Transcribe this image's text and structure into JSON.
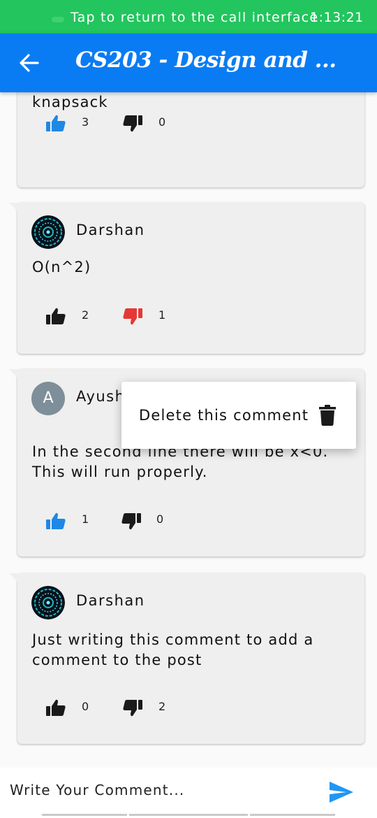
{
  "call_banner": {
    "message": "Tap to return to the call interface",
    "time": "1:13:21"
  },
  "header": {
    "title": "CS203 - Design and ...",
    "back_icon": "arrow-left-icon"
  },
  "colors": {
    "call_banner": "#22c55e",
    "app_bar": "#0a7cf3",
    "like_active": "#1e88e5",
    "dislike_active": "#e53935",
    "icon_neutral": "#1a1a1a",
    "send_icon": "#2196f3"
  },
  "comments": [
    {
      "text": "knapsack",
      "likes": "3",
      "dislikes": "0",
      "liked": true,
      "disliked": false
    },
    {
      "author": "Darshan",
      "text": "O(n^2)",
      "likes": "2",
      "dislikes": "1",
      "liked": false,
      "disliked": true
    },
    {
      "author": "Ayush",
      "avatar_letter": "A",
      "text": "In the second line there will be x<0. This will run properly.",
      "likes": "1",
      "dislikes": "0",
      "liked": true,
      "disliked": false
    },
    {
      "author": "Darshan",
      "text": "Just writing this comment to add a comment to the post",
      "likes": "0",
      "dislikes": "2",
      "liked": false,
      "disliked": false
    }
  ],
  "context_menu": {
    "label": "Delete this comment",
    "icon": "trash-icon"
  },
  "composer": {
    "placeholder": "Write Your Comment...",
    "send_icon": "send-icon"
  }
}
